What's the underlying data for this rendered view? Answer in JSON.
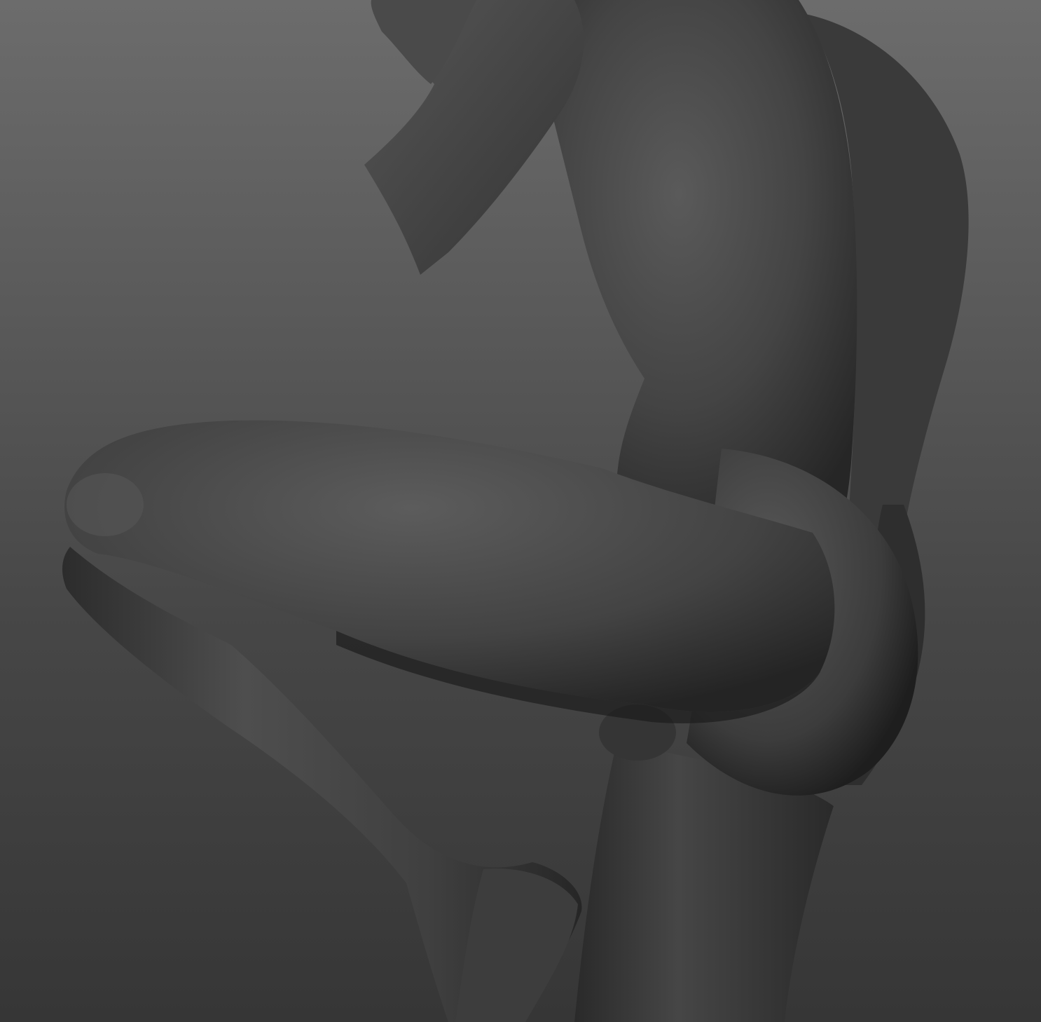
{
  "viewport": {
    "background_top": "#6c6c6c",
    "background_bottom": "#363636",
    "material_color": "#3c3c3c",
    "highlight_color": "#5a5a5a",
    "shadow_color": "#1a1a1a"
  },
  "model": {
    "icon": "sculpted-figure-icon"
  }
}
